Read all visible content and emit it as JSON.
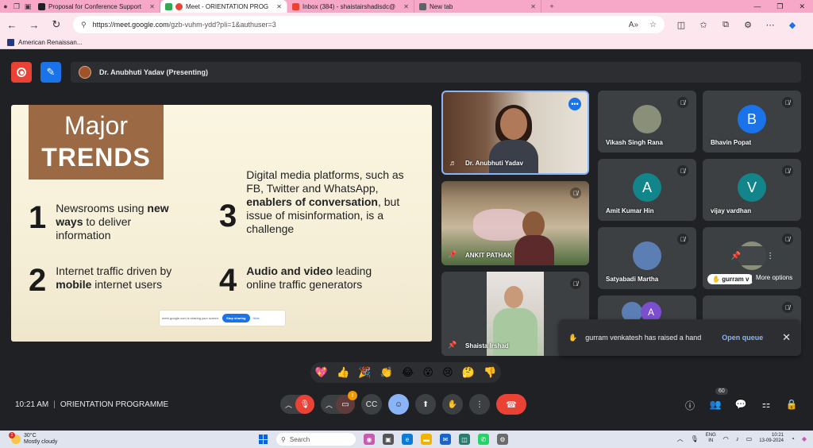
{
  "browser": {
    "tabs": [
      {
        "label": "Proposal for Conference Support",
        "fav_color": "#202124",
        "active": false
      },
      {
        "label": "Meet - ORIENTATION PROG",
        "fav_color": "#34a853",
        "active": true
      },
      {
        "label": "Inbox (384) - shaistairshadisdc@",
        "fav_color": "#ea4335",
        "active": false
      },
      {
        "label": "New tab",
        "fav_color": "#5f6368",
        "active": false
      }
    ],
    "url_host": "https://meet.google.com",
    "url_path": "/gzb-vuhm-ydd?pli=1&authuser=3",
    "bookmark": "American Renaissan..."
  },
  "meet": {
    "presenting_label": "Dr. Anubhuti Yadav (Presenting)",
    "slide": {
      "title_line1": "Major",
      "title_line2": "TRENDS",
      "p1_num": "1",
      "p1_a": "Newsrooms using ",
      "p1_b": "new ways",
      "p1_c": " to deliver information",
      "p2_num": "2",
      "p2_a": "Internet traffic driven by ",
      "p2_b": "mobile",
      "p2_c": " internet users",
      "p3_num": "3",
      "p3_a": "Digital media platforms, such as FB, Twitter and WhatsApp, ",
      "p3_b": "enablers of conversation",
      "p3_c": ", but issue of misinformation, is a challenge",
      "p4_num": "4",
      "p4_b": "Audio and video",
      "p4_c": " leading online traffic generators",
      "share_text": "meet.google.com is sharing your screen.",
      "stop_sharing": "Stop sharing",
      "hide": "Hide"
    },
    "tiles": {
      "presenter": "Dr. Anubhuti Yadav",
      "ankit": "ANKIT PATHAK",
      "shaista": "Shaista Irshad",
      "vikash": "Vikash Singh Rana",
      "bhavin": "Bhavin Popat",
      "bhavin_initial": "B",
      "amit": "Amit Kumar Hin",
      "amit_initial": "A",
      "vijay": "vijay vardhan",
      "vijay_initial": "V",
      "satyabadi": "Satyabadi Martha",
      "gurram": "gurram v",
      "g7_initial": "A",
      "more_options_tip": "More options"
    },
    "avatar_colors": {
      "bhavin": "#1a73e8",
      "amit": "#12858a",
      "vijay": "#12858a"
    },
    "hand_toast": {
      "message": "gurram venkatesh has raised a hand",
      "open_queue": "Open queue"
    },
    "reactions": [
      "💖",
      "👍",
      "🎉",
      "👏",
      "😂",
      "😮",
      "😢",
      "🤔",
      "👎"
    ],
    "clock": "10:21 AM",
    "meeting_name": "ORIENTATION PROGRAMME",
    "people_count": "60",
    "warn_badge": "!"
  },
  "taskbar": {
    "temp": "30°C",
    "weather": "Mostly cloudy",
    "weather_badge": "1",
    "search": "Search",
    "lang1": "ENG",
    "lang2": "IN",
    "time": "10:21",
    "date": "13-09-2024"
  }
}
